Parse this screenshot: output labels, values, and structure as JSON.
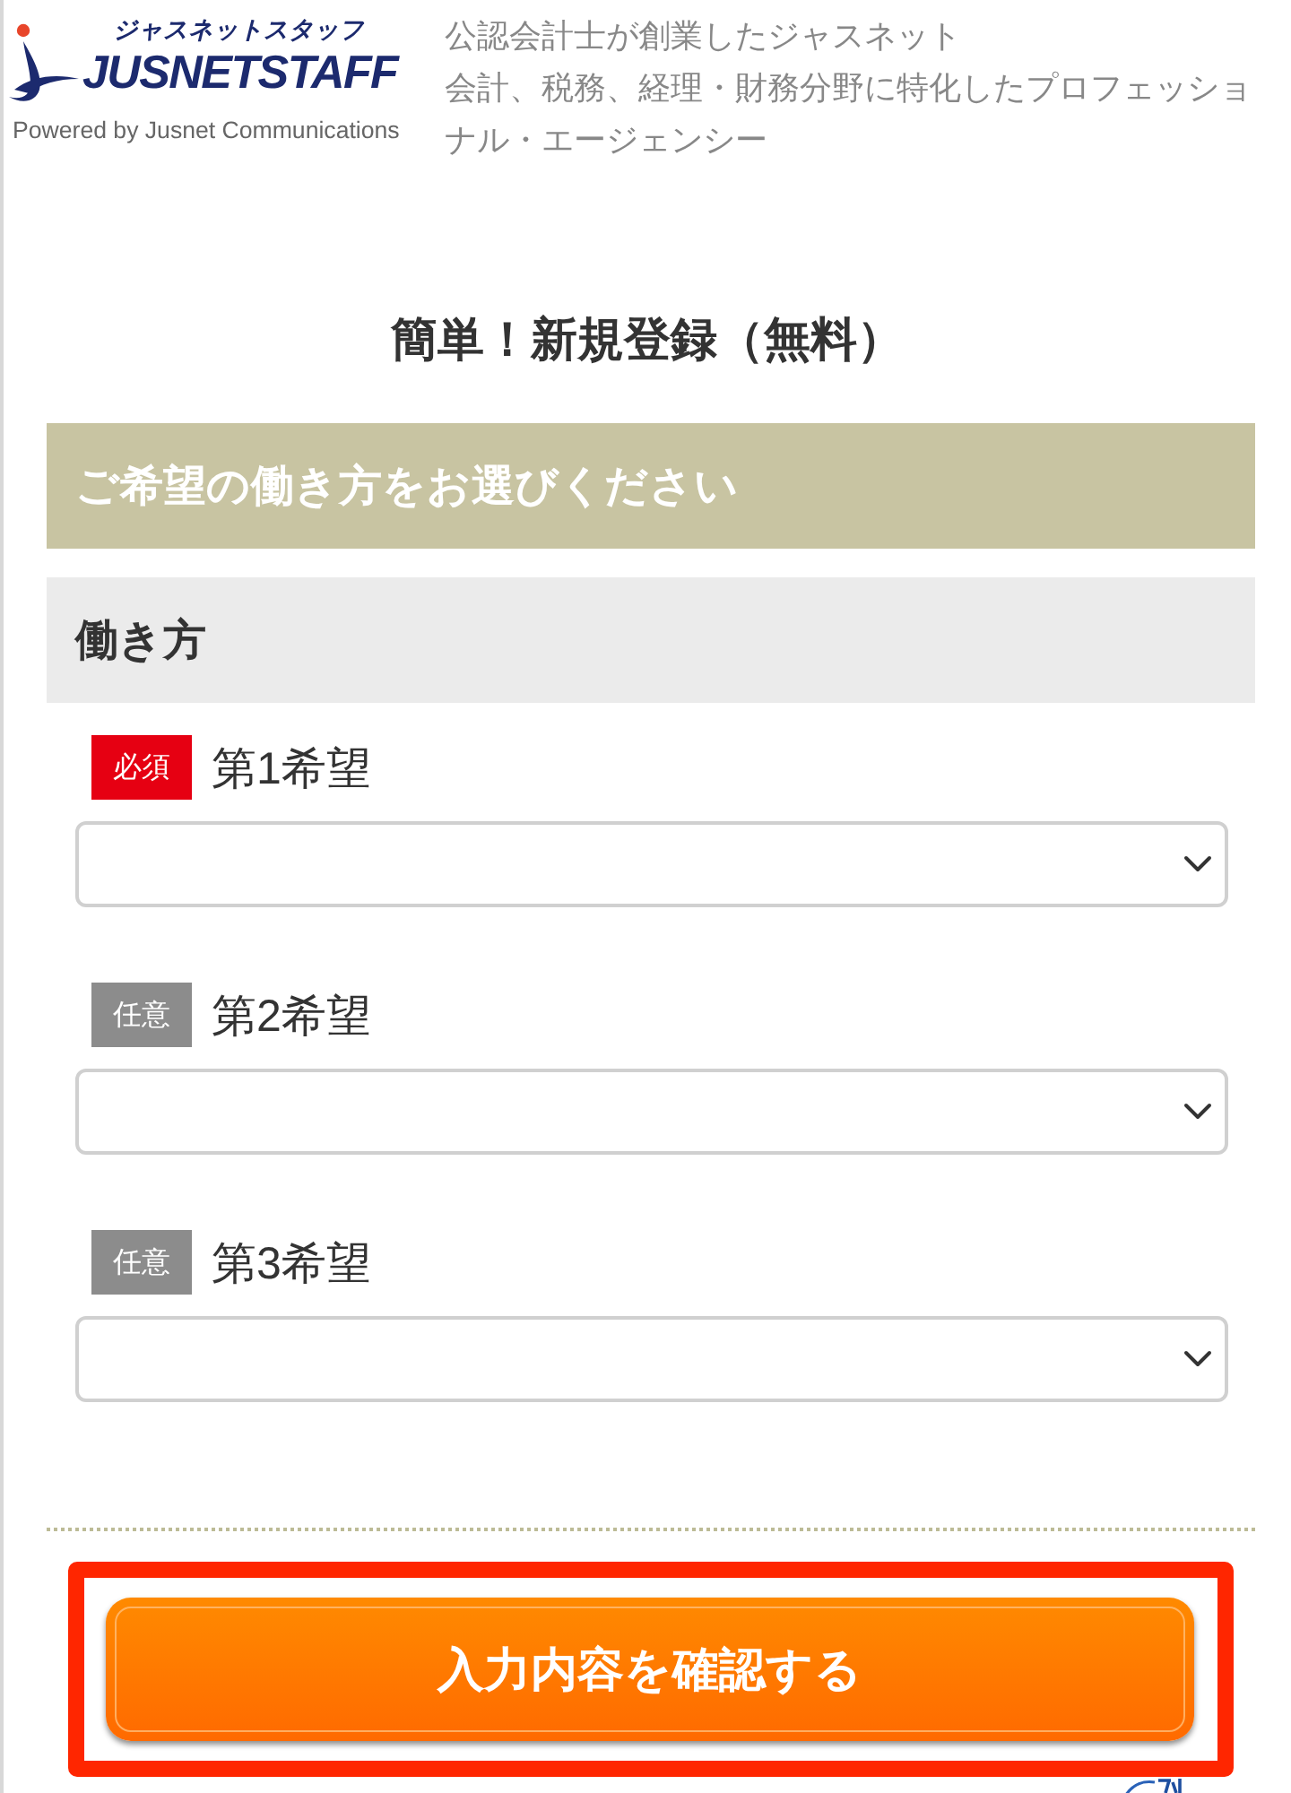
{
  "header": {
    "logo": {
      "kana": "ジャスネットスタッフ",
      "wordmark": "JUSNETSTAFF",
      "byline": "Powered by Jusnet Communications"
    },
    "tagline": [
      "公認会計士が創業したジャスネット",
      "会計、税務、経理・財務分野に特化したプロフェッショナル・エージェンシー"
    ]
  },
  "title": "簡単！新規登録（無料）",
  "section": {
    "heading": "ご希望の働き方をお選びください",
    "group": "働き方",
    "fields": [
      {
        "kind": "required",
        "badge": "必須",
        "label": "第1希望"
      },
      {
        "kind": "optional",
        "badge": "任意",
        "label": "第2希望"
      },
      {
        "kind": "optional",
        "badge": "任意",
        "label": "第3希望"
      }
    ]
  },
  "submit": {
    "label": "入力内容を確認する",
    "highlighted": true
  }
}
